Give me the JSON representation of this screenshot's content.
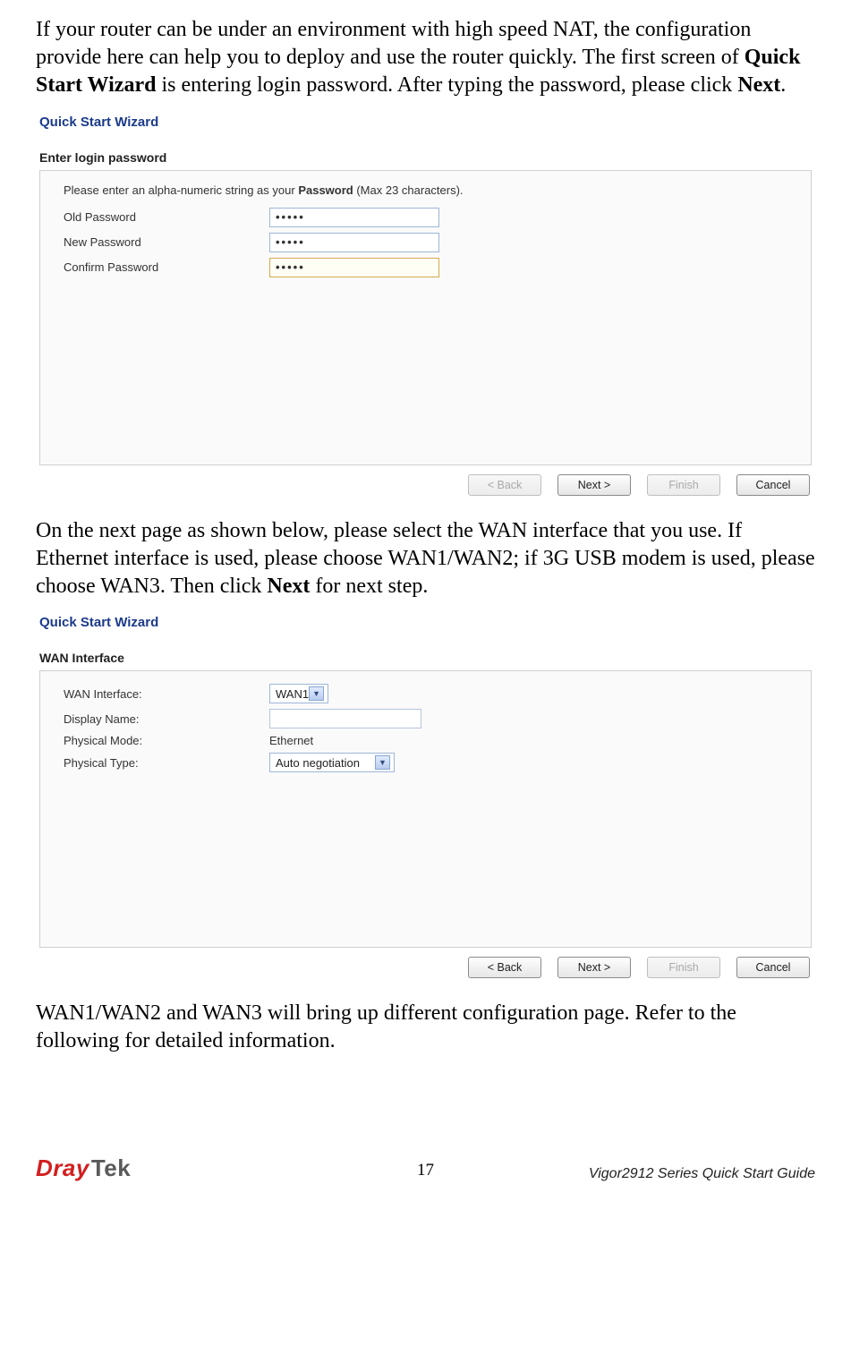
{
  "para1_a": "If your router can be under an environment with high speed NAT, the configuration provide here can help you to deploy and use the router quickly. The first screen of ",
  "para1_b": "Quick Start Wizard",
  "para1_c": " is entering login password. After typing the password, please click ",
  "para1_d": "Next",
  "para1_e": ".",
  "shot1": {
    "title": "Quick Start Wizard",
    "section": "Enter login password",
    "instr_a": "Please enter an alpha-numeric string as your  ",
    "instr_b": "Password",
    "instr_c": " (Max 23 characters).",
    "rows": {
      "old": "Old Password",
      "new": "New Password",
      "confirm": "Confirm Password"
    },
    "dots": "•••••",
    "buttons": {
      "back": "< Back",
      "next": "Next >",
      "finish": "Finish",
      "cancel": "Cancel"
    }
  },
  "para2_a": "On the next page as shown below, please select the WAN interface that you use. If Ethernet interface is used, please choose WAN1/WAN2; if 3G USB modem is used, please choose WAN3. Then click ",
  "para2_b": "Next",
  "para2_c": " for next step.",
  "shot2": {
    "title": "Quick Start Wizard",
    "section": "WAN Interface",
    "rows": {
      "wanif": "WAN Interface:",
      "disp": "Display Name:",
      "pmode": "Physical Mode:",
      "ptype": "Physical Type:"
    },
    "values": {
      "wanif": "WAN1",
      "pmode": "Ethernet",
      "ptype": "Auto negotiation"
    },
    "buttons": {
      "back": "< Back",
      "next": "Next >",
      "finish": "Finish",
      "cancel": "Cancel"
    }
  },
  "para3": "WAN1/WAN2 and WAN3 will bring up different configuration page. Refer to the following for detailed information.",
  "footer": {
    "logo_a": "Dray",
    "logo_b": "Tek",
    "page": "17",
    "guide": "Vigor2912 Series Quick Start Guide"
  }
}
